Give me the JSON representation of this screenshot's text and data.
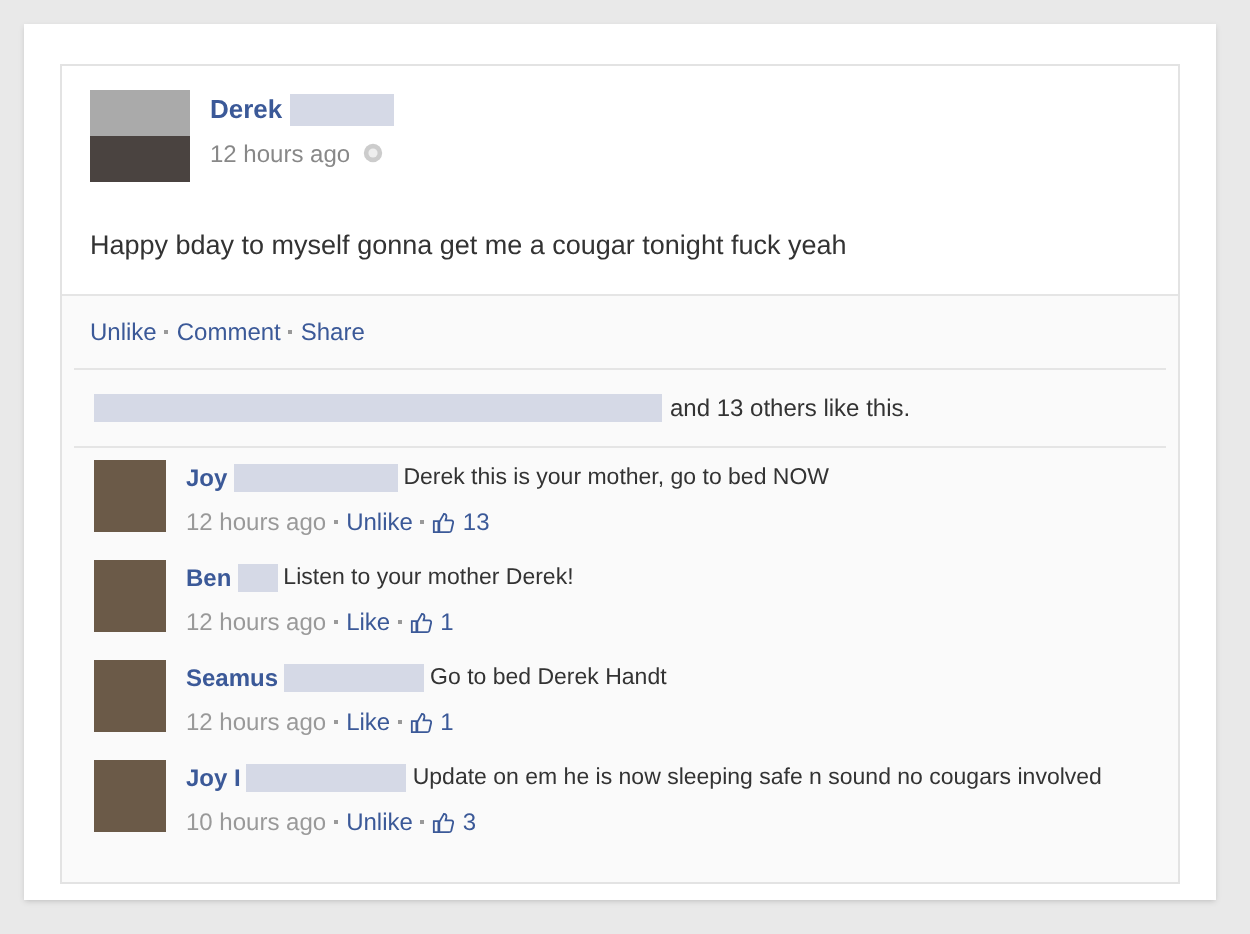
{
  "post": {
    "author": "Derek",
    "time": "12 hours ago",
    "text": "Happy bday to myself gonna get me a cougar tonight fuck yeah",
    "actions": [
      "Unlike",
      "Comment",
      "Share"
    ],
    "likes_text": "and 13 others like this."
  },
  "comments": [
    {
      "author": "Joy",
      "text": "Derek this is your mother, go to bed NOW",
      "time": "12 hours ago",
      "action": "Unlike",
      "likes": "13"
    },
    {
      "author": "Ben",
      "text": "Listen to your mother Derek!",
      "time": "12 hours ago",
      "action": "Like",
      "likes": "1"
    },
    {
      "author": "Seamus",
      "text": "Go to bed Derek Handt",
      "time": "12 hours ago",
      "action": "Like",
      "likes": "1"
    },
    {
      "author": "Joy I",
      "text": "Update on em he is now sleeping safe n sound no cougars involved",
      "time": "10 hours ago",
      "action": "Unlike",
      "likes": "3"
    }
  ]
}
